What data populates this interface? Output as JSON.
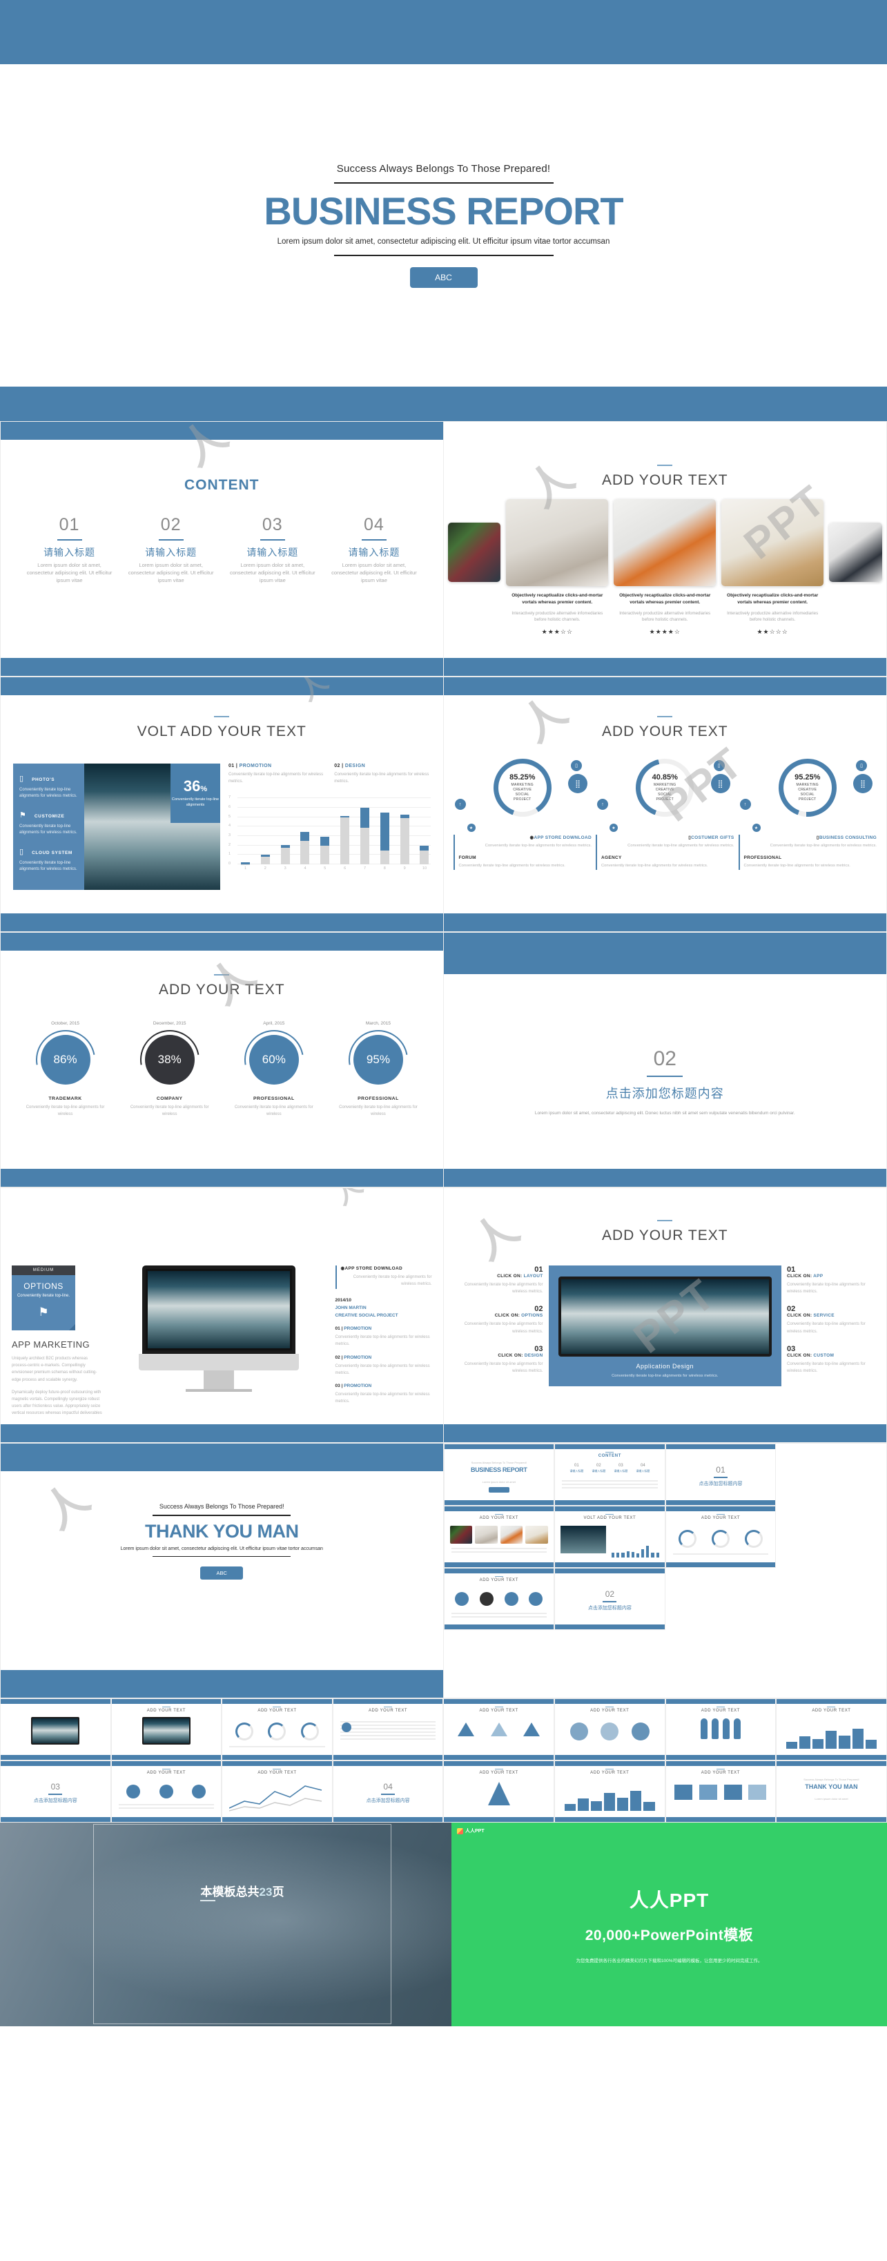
{
  "cover": {
    "tagline": "Success Always Belongs To Those Prepared!",
    "title": "BUSINESS REPORT",
    "subtitle": "Lorem ipsum dolor sit amet, consectetur adipiscing elit. Ut efficitur ipsum vitae tortor accumsan",
    "button": "ABC"
  },
  "slide_content": {
    "title": "CONTENT",
    "items": [
      {
        "num": "01",
        "title": "请输入标题",
        "desc": "Lorem ipsum dolor sit amet, consectetur adipiscing elit. Ut efficitur ipsum vitae"
      },
      {
        "num": "02",
        "title": "请输入标题",
        "desc": "Lorem ipsum dolor sit amet, consectetur adipiscing elit. Ut efficitur ipsum vitae"
      },
      {
        "num": "03",
        "title": "请输入标题",
        "desc": "Lorem ipsum dolor sit amet, consectetur adipiscing elit. Ut efficitur ipsum vitae"
      },
      {
        "num": "04",
        "title": "请输入标题",
        "desc": "Lorem ipsum dolor sit amet, consectetur adipiscing elit. Ut efficitur ipsum vitae"
      }
    ]
  },
  "slide_photos": {
    "title": "ADD YOUR TEXT",
    "cards": [
      {
        "caption": "Objectively recaptiualize clicks-and-mortar vortals whereas premier content.",
        "sub": "Interactively productize alternative infomediaries before holistic channels.",
        "stars": "★★★☆☆"
      },
      {
        "caption": "Objectively recaptiualize clicks-and-mortar vortals whereas premier content.",
        "sub": "Interactively productize alternative infomediaries before holistic channels.",
        "stars": "★★★★☆"
      },
      {
        "caption": "Objectively recaptiualize clicks-and-mortar vortals whereas premier content.",
        "sub": "Interactively productize alternative infomediaries before holistic channels.",
        "stars": "★★☆☆☆"
      }
    ]
  },
  "slide_volt": {
    "title": "VOLT ADD YOUR TEXT",
    "features": [
      {
        "icon": "phone-icon",
        "glyph": "▯",
        "title": "PHOTO'S",
        "text": "Conveniently iterate top-line alignments for wireless metrics."
      },
      {
        "icon": "design-icon",
        "glyph": "⚑",
        "title": "CUSTOMIZE",
        "text": "Conveniently iterate top-line alignments for wireless metrics."
      },
      {
        "icon": "cloud-icon",
        "glyph": "▯",
        "title": "CLOUD SYSTEM",
        "text": "Conveniently iterate top-line alignments for wireless metrics."
      }
    ],
    "badge_value": "36",
    "badge_unit": "%",
    "badge_text": "Conveniently iterate top-line alignments",
    "columns": [
      {
        "key": "01 | ",
        "key_em": "PROMOTION",
        "text": "Conveniently iterate top-line alignments for wireless metrics."
      },
      {
        "key": "02 | ",
        "key_em": "DESIGN",
        "text": "Conveniently iterate top-line alignments for wireless metrics."
      }
    ],
    "chart_ref": 0
  },
  "slide_donut": {
    "title": "ADD YOUR TEXT",
    "items": [
      {
        "pct": "85.25%",
        "label": "MARKETING CREATIVE SOCIAL PROJECT",
        "head_pre": "",
        "head_em": "APP STORE DOWNLOAD",
        "text": "Conveniently iterate top-line alignments for wireless metrics.",
        "sub": "FORUM",
        "subtext": "Conveniently iterate top-line alignments for wireless metrics.",
        "icon": "speaker-icon"
      },
      {
        "pct": "40.85%",
        "label": "MARKETING CREATIVE SOCIAL PROJECT",
        "head_pre": "",
        "head_em": "COSTUMER GIFTS",
        "text": "Conveniently iterate top-line alignments for wireless metrics.",
        "sub": "AGENCY",
        "subtext": "Conveniently iterate top-line alignments for wireless metrics.",
        "icon": "gift-icon"
      },
      {
        "pct": "95.25%",
        "label": "MARKETING CREATIVE SOCIAL PROJECT",
        "head_pre": "",
        "head_em": "BUSINESS CONSULTING",
        "text": "Conveniently iterate top-line alignments for wireless metrics.",
        "sub": "PROFESSIONAL",
        "subtext": "Conveniently iterate top-line alignments for wireless metrics.",
        "icon": "briefcase-icon"
      }
    ]
  },
  "slide_percent": {
    "title": "ADD YOUR TEXT",
    "items": [
      {
        "date": "October, 2015",
        "pct": "86%",
        "title": "TRADEMARK",
        "text": "Conveniently iterate top-line alignments for wireless",
        "color": "#4a80ac"
      },
      {
        "date": "December, 2015",
        "pct": "38%",
        "title": "COMPANY",
        "text": "Conveniently iterate top-line alignments for wireless",
        "color": "#34353a"
      },
      {
        "date": "April, 2015",
        "pct": "60%",
        "title": "PROFESSIONAL",
        "text": "Conveniently iterate top-line alignments for wireless",
        "color": "#4a80ac"
      },
      {
        "date": "March, 2015",
        "pct": "95%",
        "title": "PROFESSIONAL",
        "text": "Conveniently iterate top-line alignments for wireless",
        "color": "#4a80ac"
      }
    ]
  },
  "slide_divider": {
    "num": "02",
    "title": "点击添加您标题内容",
    "text": "Lorem ipsum dolor sit amet, consectetur adipiscing elit. Donec luctus nibh sit amet sem vulputate venenatis bibendum orci pulvinar."
  },
  "slide_app": {
    "card_header": "MEDIUM",
    "card_title": "OPTIONS",
    "card_sub": "Conveniently iterate top-line.",
    "card_icon": "design-icon",
    "heading": "APP MARKETING",
    "para1": "Uniquely architect B2C products whereas process-centric e-markets. Compellingly envisioneer premium schemas without cutting-edge process and scalable synergy.",
    "para2": "Dynamically deploy future-proof outsourcing with magnetic vortals. Compellingly synergize robust users after frictionless value. Appropriately seize vertical resources whereas impactful deliverables",
    "right": {
      "head_em": "APP STORE DOWNLOAD",
      "head_text": "Conveniently iterate top-line alignments for wireless metrics.",
      "meta_date": "2014/10",
      "meta_name": "JOHN MARTIN",
      "meta_role": "CREATIVE SOCIAL PROJECT",
      "keys": [
        {
          "k": "01 | ",
          "em": "PROMOTION",
          "t": "Conveniently iterate top-line alignments for wireless metrics."
        },
        {
          "k": "02 | ",
          "em": "PROMOTION",
          "t": "Conveniently iterate top-line alignments for wireless metrics."
        },
        {
          "k": "03 | ",
          "em": "PROMOTION",
          "t": "Conveniently iterate top-line alignments for wireless metrics."
        }
      ]
    }
  },
  "slide_design": {
    "title": "ADD YOUR TEXT",
    "left": [
      {
        "num": "01",
        "k": "CLICK ON: ",
        "em": "LAYOUT",
        "t": "Conveniently iterate top-line alignments for wireless metrics."
      },
      {
        "num": "02",
        "k": "CLICK ON: ",
        "em": "OPTIONS",
        "t": "Conveniently iterate top-line alignments for wireless metrics."
      },
      {
        "num": "03",
        "k": "CLICK ON: ",
        "em": "DESIGN",
        "t": "Conveniently iterate top-line alignments for wireless metrics."
      }
    ],
    "right": [
      {
        "num": "01",
        "k": "CLICK ON: ",
        "em": "APP",
        "t": "Conveniently iterate top-line alignments for wireless metrics."
      },
      {
        "num": "02",
        "k": "CLICK ON: ",
        "em": "SERVICE",
        "t": "Conveniently iterate top-line alignments for wireless metrics."
      },
      {
        "num": "03",
        "k": "CLICK ON: ",
        "em": "CUSTOM",
        "t": "Conveniently iterate top-line alignments for wireless metrics."
      }
    ],
    "caption": "Application Design",
    "caption_sub": "Conveniently iterate top-line alignments for wireless metrics."
  },
  "slide_thanks": {
    "tagline": "Success Always Belongs To Those Prepared!",
    "title": "THANK YOU MAN",
    "subtitle": "Lorem ipsum dolor sit amet, consectetur adipiscing elit. Ut efficitur ipsum vitae tortor accumsan",
    "button": "ABC"
  },
  "thumbnails": [
    {
      "kind": "cover",
      "label": "BUSINESS REPORT"
    },
    {
      "kind": "content",
      "label": "CONTENT"
    },
    {
      "kind": "section",
      "num": "01",
      "label": "点击添加您标题内容"
    },
    {
      "kind": "photos",
      "label": "ADD YOUR TEXT"
    },
    {
      "kind": "volt",
      "label": "VOLT ADD YOUR TEXT"
    },
    {
      "kind": "donut",
      "label": "ADD YOUR TEXT"
    },
    {
      "kind": "circles",
      "label": "ADD YOUR TEXT"
    },
    {
      "kind": "section",
      "num": "02",
      "label": "点击添加您标题内容"
    },
    {
      "kind": "monitor",
      "label": ""
    },
    {
      "kind": "monitor2",
      "label": "ADD YOUR TEXT"
    },
    {
      "kind": "donut2",
      "label": "ADD YOUR TEXT"
    },
    {
      "kind": "lines",
      "label": "ADD YOUR TEXT"
    },
    {
      "kind": "triangles",
      "label": "ADD YOUR TEXT"
    },
    {
      "kind": "venn",
      "label": "ADD YOUR TEXT"
    },
    {
      "kind": "people",
      "label": "ADD YOUR TEXT"
    },
    {
      "kind": "bars2",
      "label": "ADD YOUR TEXT"
    },
    {
      "kind": "section",
      "num": "03",
      "label": "点击添加您标题内容"
    },
    {
      "kind": "dots",
      "label": "ADD YOUR TEXT"
    },
    {
      "kind": "linechart",
      "label": "ADD YOUR TEXT"
    },
    {
      "kind": "section",
      "num": "04",
      "label": "点击添加您标题内容"
    },
    {
      "kind": "tree",
      "label": "ADD YOUR TEXT"
    },
    {
      "kind": "bars3",
      "label": "ADD YOUR TEXT"
    },
    {
      "kind": "blue4",
      "label": "ADD YOUR TEXT"
    },
    {
      "kind": "thanks",
      "label": "THANK YOU MAN"
    }
  ],
  "footer": {
    "caption_prefix": "本模板总共",
    "caption_num": "23",
    "caption_suffix": "页",
    "brand": "人人PPT",
    "brand_sub": "20,000+PowerPoint模板",
    "brand_note": "为您免费提供各行各业的精美幻灯片下载和100%可编辑的模板，让您用更少的时间完成工作。",
    "logo_label": "人人PPT"
  },
  "colors": {
    "primary": "#4a80ac",
    "dark": "#34353a",
    "green": "#34cf68",
    "muted": "#b0b0b0"
  },
  "chart_data": [
    {
      "type": "bar",
      "title": "",
      "xlabel": "",
      "ylabel": "",
      "categories": [
        "1",
        "2",
        "3",
        "4",
        "5",
        "6",
        "7",
        "8",
        "9",
        "10"
      ],
      "ylim": [
        0,
        7
      ],
      "yticks": [
        0,
        1,
        2,
        3,
        4,
        5,
        6,
        7
      ],
      "grid": true,
      "legend": "none",
      "series": [
        {
          "name": "base",
          "color": "#d7d7d7",
          "values": [
            0.05,
            0.8,
            1.8,
            2.5,
            2.0,
            5.0,
            3.9,
            1.5,
            4.9,
            1.5
          ]
        },
        {
          "name": "top",
          "color": "#4a80ac",
          "values": [
            0.2,
            0.25,
            0.25,
            0.95,
            0.9,
            0.1,
            2.1,
            4.0,
            0.4,
            0.5
          ]
        }
      ]
    },
    {
      "type": "pie",
      "subtype": "donut-progress",
      "title": "ADD YOUR TEXT",
      "categories": [
        "MARKETING CREATIVE SOCIAL PROJECT",
        "MARKETING CREATIVE SOCIAL PROJECT",
        "MARKETING CREATIVE SOCIAL PROJECT"
      ],
      "values": [
        85.25,
        40.85,
        95.25
      ],
      "unit": "%",
      "color": "#4a80ac",
      "track": "#efefef"
    },
    {
      "type": "pie",
      "subtype": "percent-circle",
      "title": "ADD YOUR TEXT",
      "categories": [
        "TRADEMARK",
        "COMPANY",
        "PROFESSIONAL",
        "PROFESSIONAL"
      ],
      "labels": [
        "October, 2015",
        "December, 2015",
        "April, 2015",
        "March, 2015"
      ],
      "values": [
        86,
        38,
        60,
        95
      ],
      "unit": "%",
      "colors": [
        "#4a80ac",
        "#34353a",
        "#4a80ac",
        "#4a80ac"
      ]
    }
  ]
}
